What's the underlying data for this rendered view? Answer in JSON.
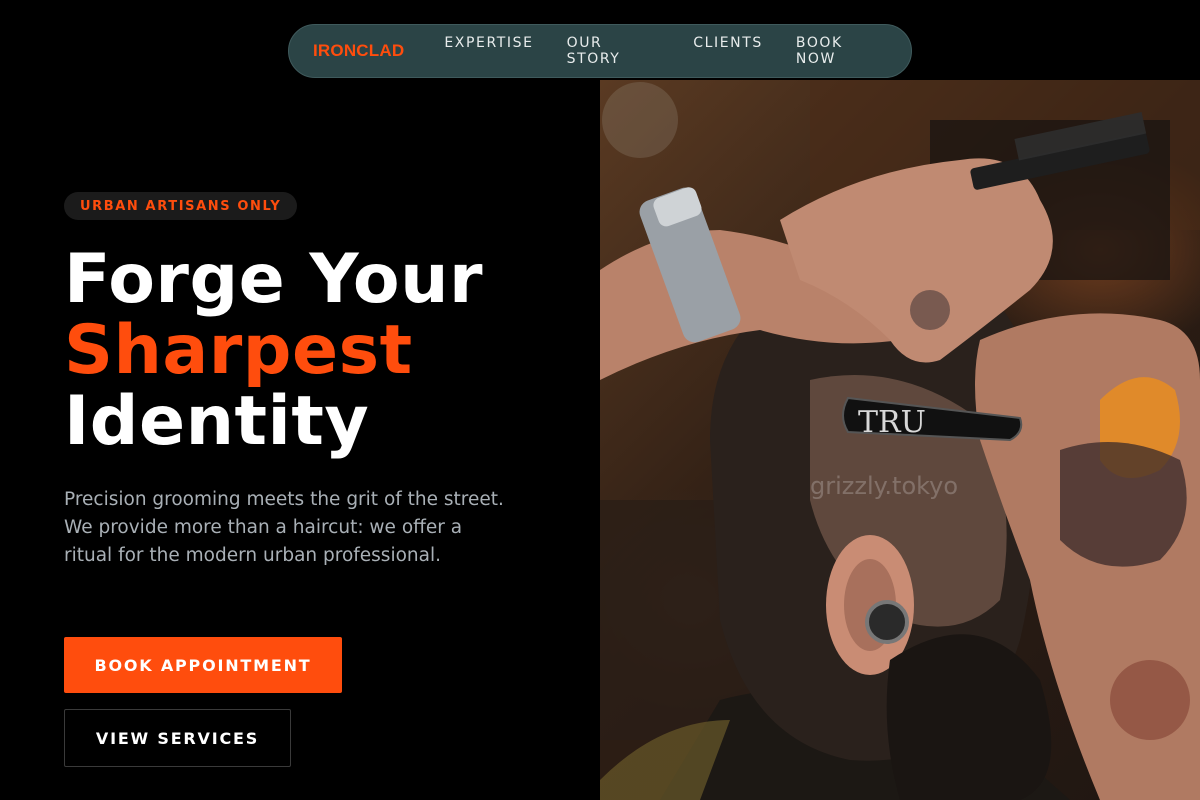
{
  "nav": {
    "brand": "IRONCLAD",
    "links": [
      "EXPERTISE",
      "OUR STORY",
      "CLIENTS",
      "BOOK NOW"
    ]
  },
  "hero": {
    "badge": "URBAN ARTISANS ONLY",
    "headline_line1": "Forge Your",
    "headline_accent": "Sharpest",
    "headline_line3": "Identity",
    "description": "Precision grooming meets the grit of the street. We provide more than a haircut: we offer a ritual for the modern urban professional.",
    "primary_button": "BOOK APPOINTMENT",
    "secondary_button": "VIEW SERVICES"
  },
  "image": {
    "alt": "barber-cutting-hair-photo",
    "razor_text": "TRU",
    "watermark": "grizzly.tokyo"
  },
  "colors": {
    "accent": "#ff4d0d",
    "nav_bg": "#2b4446",
    "background": "#000000",
    "muted_text": "#a9b0b6"
  }
}
